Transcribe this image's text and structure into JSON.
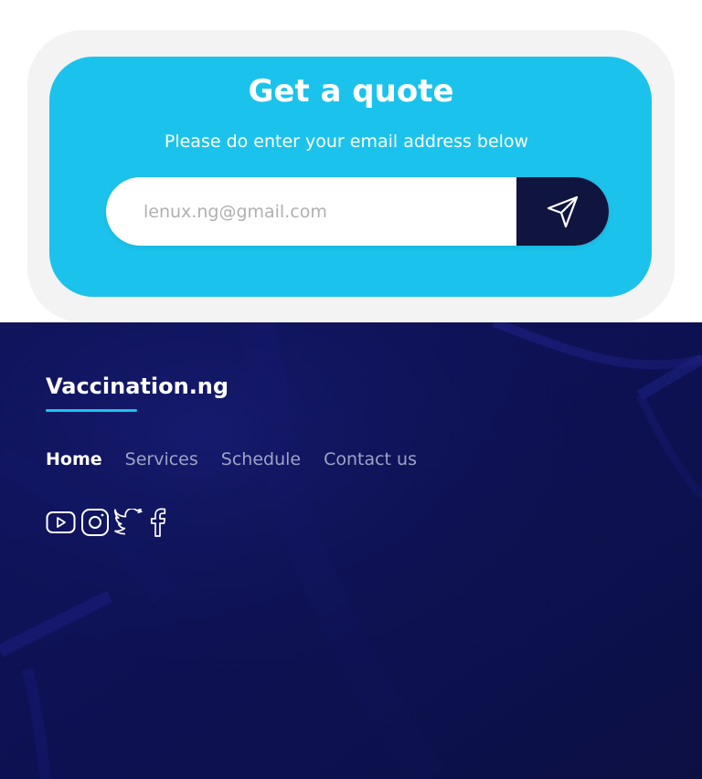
{
  "quote": {
    "title": "Get a quote",
    "subtitle": "Please do enter your email address below",
    "email_placeholder": "lenux.ng@gmail.com",
    "send_icon": "paper-plane-icon"
  },
  "footer": {
    "brand": "Vaccination.ng",
    "nav": [
      {
        "label": "Home",
        "active": true
      },
      {
        "label": "Services",
        "active": false
      },
      {
        "label": "Schedule",
        "active": false
      },
      {
        "label": "Contact us",
        "active": false
      }
    ],
    "socials": [
      "youtube-icon",
      "instagram-icon",
      "twitter-icon",
      "facebook-icon"
    ]
  },
  "colors": {
    "accent": "#1bc3ec",
    "dark_navy": "#10153f",
    "footer_bg": "#0e1258",
    "card_outer": "#f3f3f3"
  }
}
